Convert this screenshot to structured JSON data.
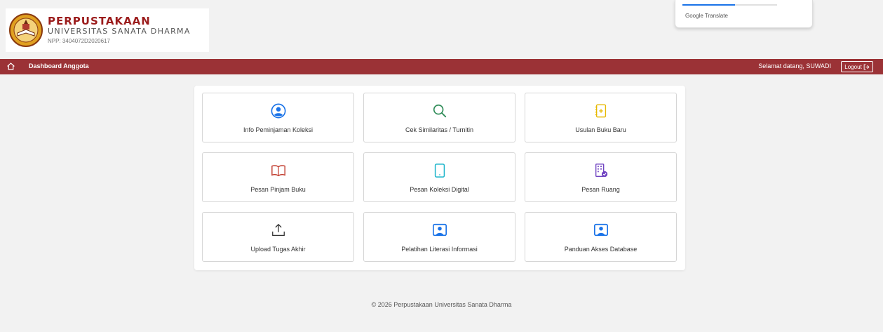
{
  "header": {
    "title": "PERPUSTAKAAN",
    "subtitle": "UNIVERSITAS SANATA DHARMA",
    "npp": "NPP: 3404072D2020617",
    "logo_icon": "university-seal-icon"
  },
  "translate_popup": {
    "label": "Google Translate"
  },
  "navbar": {
    "home_icon": "home-icon",
    "title": "Dashboard Anggota",
    "welcome": "Selamat datang, SUWADI",
    "logout_label": "Logout",
    "logout_icon": "logout-icon",
    "bg_color": "#9b3236"
  },
  "menu": [
    {
      "label": "Info Peminjaman Koleksi",
      "icon": "user-circle-icon",
      "color": "#1a73e8"
    },
    {
      "label": "Cek Similaritas / Turnitin",
      "icon": "search-icon",
      "color": "#2e8b57"
    },
    {
      "label": "Usulan Buku Baru",
      "icon": "journal-plus-icon",
      "color": "#e6b800"
    },
    {
      "label": "Pesan Pinjam Buku",
      "icon": "open-book-icon",
      "color": "#c0392b"
    },
    {
      "label": "Pesan Koleksi Digital",
      "icon": "tablet-icon",
      "color": "#17b3c9"
    },
    {
      "label": "Pesan Ruang",
      "icon": "building-check-icon",
      "color": "#6f42c1"
    },
    {
      "label": "Upload Tugas Akhir",
      "icon": "upload-icon",
      "color": "#333333"
    },
    {
      "label": "Pelatihan Literasi Informasi",
      "icon": "person-video-icon",
      "color": "#1a73e8"
    },
    {
      "label": "Panduan Akses Database",
      "icon": "person-video-icon",
      "color": "#1a73e8"
    }
  ],
  "footer": {
    "text": "© 2026 Perpustakaan Universitas Sanata Dharma"
  }
}
